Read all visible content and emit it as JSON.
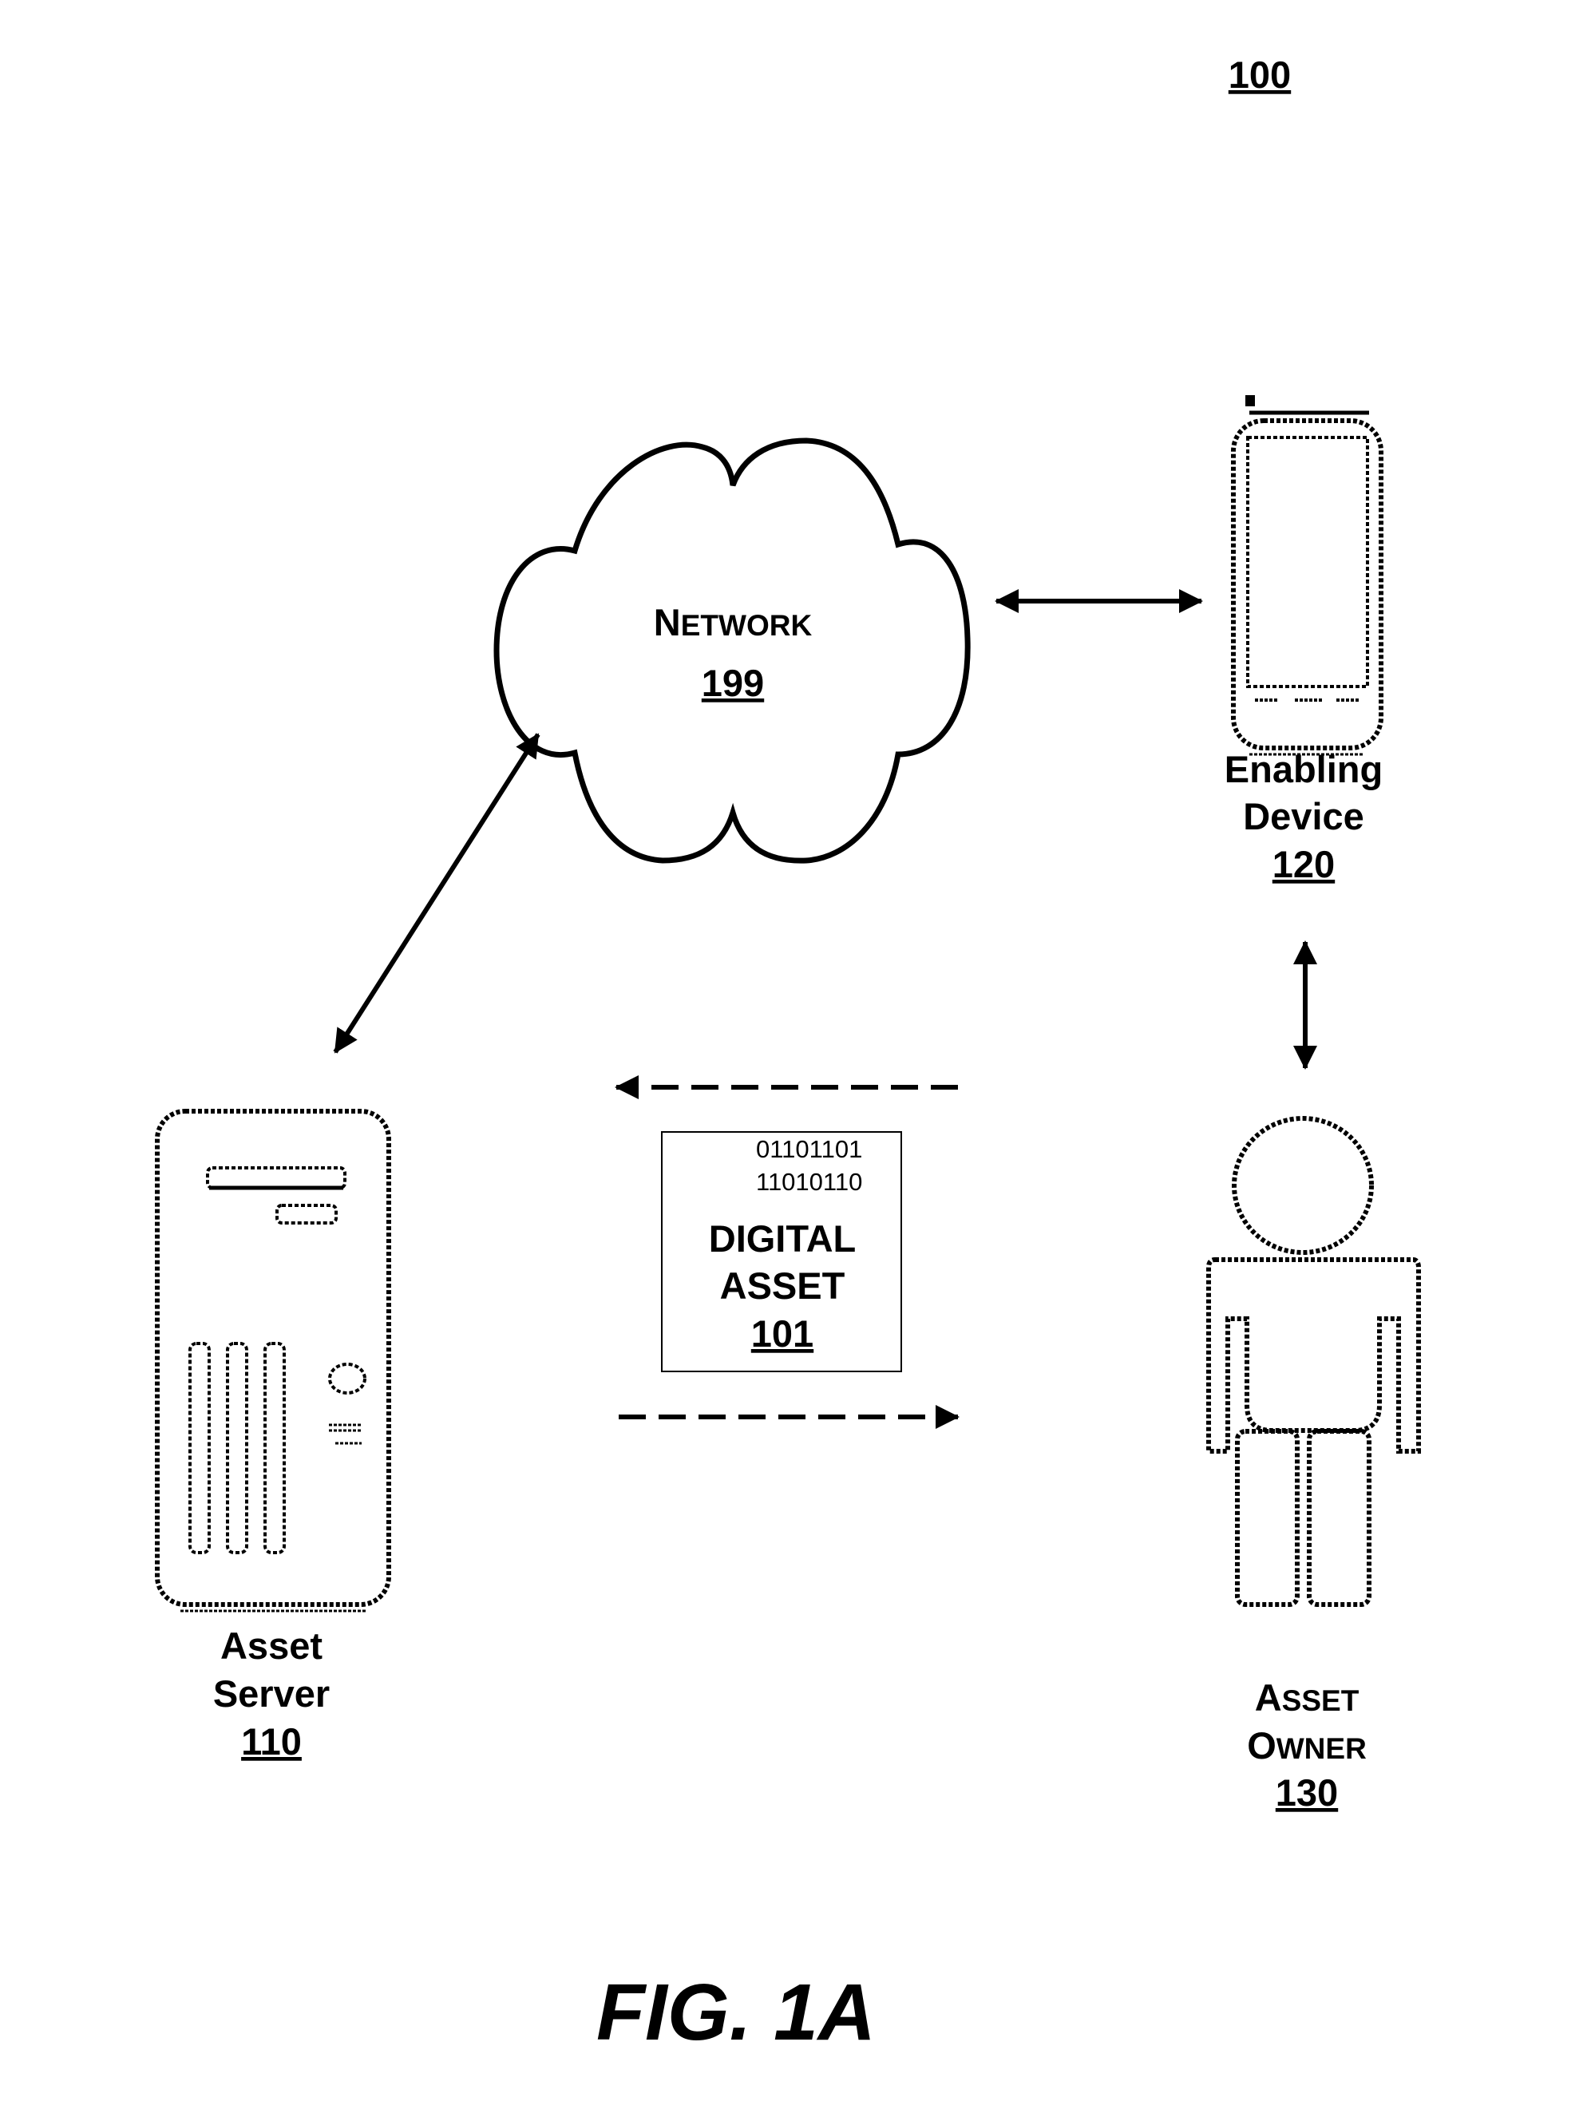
{
  "figure": {
    "reference": "100",
    "caption": "FIG. 1A"
  },
  "network": {
    "label_first": "N",
    "label_rest": "ETWORK",
    "number": "199"
  },
  "enabling_device": {
    "line1": "Enabling",
    "line2": "Device",
    "number": "120"
  },
  "asset_server": {
    "line1": "Asset",
    "line2": "Server",
    "number": "110"
  },
  "asset_owner": {
    "line1_first": "A",
    "line1_rest": "SSET",
    "line2_first": "O",
    "line2_rest": "WNER",
    "number": "130"
  },
  "digital_asset": {
    "bits_line1": "01101101",
    "bits_line2": "11010110",
    "line1": "DIGITAL",
    "line2": "ASSET",
    "number": "101"
  },
  "connections": [
    {
      "from": "network",
      "to": "enabling_device",
      "style": "solid",
      "direction": "bidirectional"
    },
    {
      "from": "network",
      "to": "asset_server",
      "style": "solid",
      "direction": "bidirectional"
    },
    {
      "from": "enabling_device",
      "to": "asset_owner",
      "style": "solid",
      "direction": "bidirectional"
    },
    {
      "from": "asset_owner",
      "to": "asset_server",
      "style": "dashed",
      "direction": "one-way"
    },
    {
      "from": "asset_server",
      "to": "asset_owner",
      "style": "dashed",
      "direction": "one-way"
    }
  ]
}
